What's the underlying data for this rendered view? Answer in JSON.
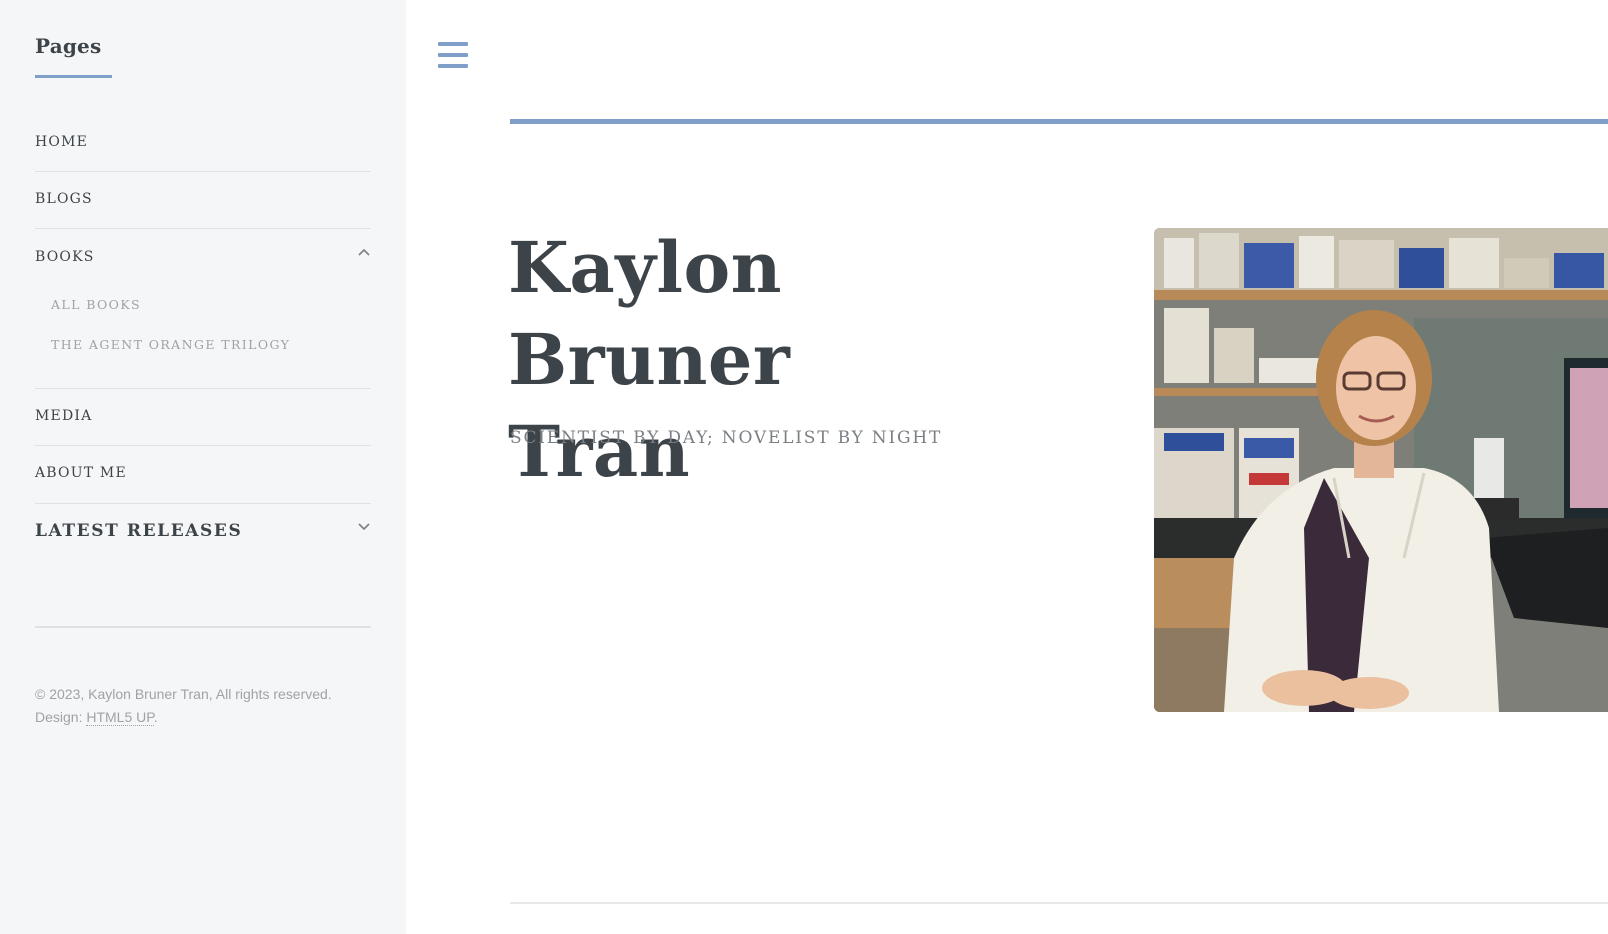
{
  "sidebar": {
    "heading": "Pages",
    "nav": [
      {
        "label": "HOME"
      },
      {
        "label": "BLOGS"
      },
      {
        "label": "BOOKS",
        "sub": [
          "ALL BOOKS",
          "THE AGENT ORANGE TRILOGY"
        ]
      },
      {
        "label": "MEDIA"
      },
      {
        "label": "ABOUT ME"
      }
    ],
    "latest_label": "LATEST RELEASES",
    "footer": {
      "copyright": "© 2023, Kaylon Bruner Tran, All rights reserved.",
      "design_prefix": "Design: ",
      "design_link": "HTML5 UP",
      "design_suffix": "."
    }
  },
  "main": {
    "title_line1": "Kaylon Bruner",
    "title_line2": "Tran",
    "subtitle": "SCIENTIST BY DAY; NOVELIST BY NIGHT"
  },
  "colors": {
    "accent": "#7f9fc9",
    "sidebar_bg": "#f5f6f7",
    "text": "#3d4449",
    "muted": "#9fa3a6"
  },
  "icons": {
    "menu": "hamburger-icon",
    "expand_open": "chevron-up-icon",
    "expand_closed": "chevron-down-icon"
  }
}
